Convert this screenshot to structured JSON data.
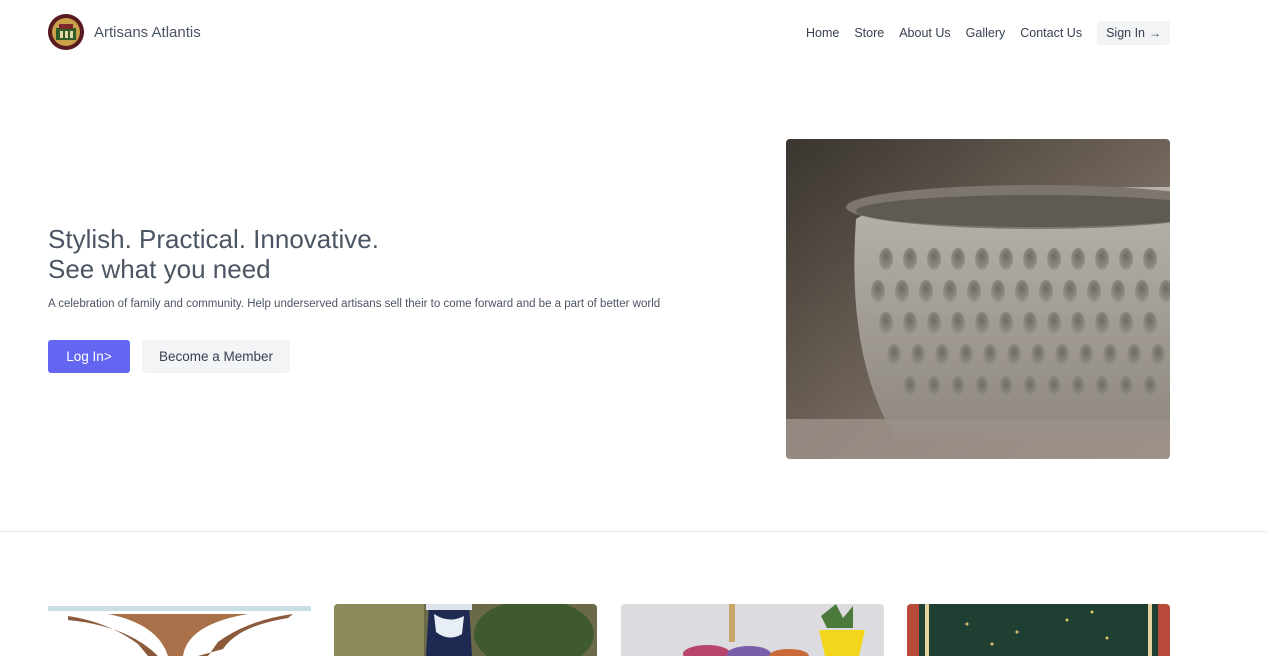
{
  "header": {
    "brand": "Artisans Atlantis",
    "nav": [
      "Home",
      "Store",
      "About Us",
      "Gallery",
      "Contact Us"
    ],
    "signin_label": "Sign In",
    "signin_icon": "arrow-right-icon"
  },
  "hero": {
    "title_line1": "Stylish. Practical. Innovative.",
    "title_line2": "See what you need",
    "subtitle": "A celebration of family and community. Help underserved artisans sell their to come forward and be a part of better world",
    "primary_button": "Log In>",
    "secondary_button": "Become a Member"
  },
  "colors": {
    "accent": "#6366f1",
    "button_secondary_bg": "#f3f4f6",
    "text": "#4b5563",
    "logo": "#5a1a22"
  }
}
